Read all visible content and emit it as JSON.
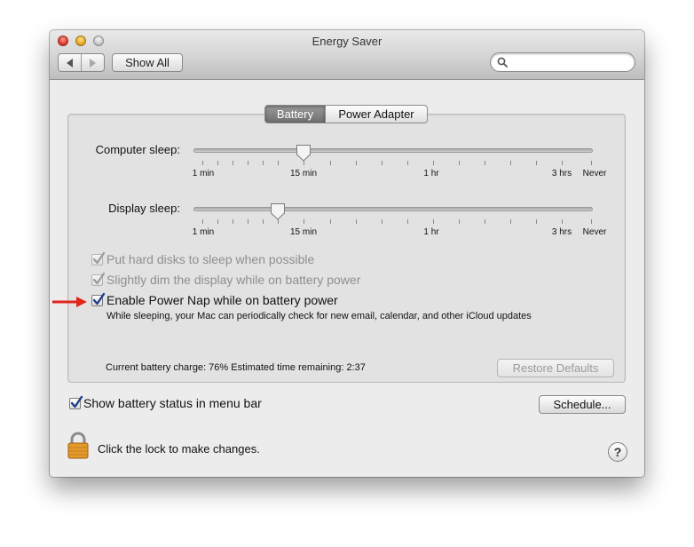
{
  "window": {
    "title": "Energy Saver"
  },
  "toolbar": {
    "show_all_label": "Show All",
    "search_placeholder": ""
  },
  "tabs": {
    "battery": "Battery",
    "power_adapter": "Power Adapter"
  },
  "computer_sleep": {
    "label": "Computer sleep:",
    "value": "15 min",
    "ticks": {
      "t1": "1 min",
      "t2": "15 min",
      "t3": "1 hr",
      "t4": "3 hrs",
      "t5": "Never"
    }
  },
  "display_sleep": {
    "label": "Display sleep:",
    "value": "10 min",
    "ticks": {
      "t1": "1 min",
      "t2": "15 min",
      "t3": "1 hr",
      "t4": "3 hrs",
      "t5": "Never"
    }
  },
  "options": {
    "hard_disks": {
      "label": "Put hard disks to sleep when possible",
      "checked": true,
      "enabled": false
    },
    "dim_display": {
      "label": "Slightly dim the display while on battery power",
      "checked": true,
      "enabled": false
    },
    "power_nap": {
      "label": "Enable Power Nap while on battery power",
      "checked": true,
      "description": "While sleeping, your Mac can periodically check for new email, calendar, and other iCloud updates"
    }
  },
  "battery_status": {
    "text": "Current battery charge: 76%  Estimated time remaining: 2:37"
  },
  "buttons": {
    "restore_defaults": "Restore Defaults",
    "schedule": "Schedule..."
  },
  "menu_bar_option": {
    "label": "Show battery status in menu bar",
    "checked": true
  },
  "lock": {
    "text": "Click the lock to make changes."
  },
  "help": {
    "label": "?"
  },
  "colors": {
    "annotation_arrow": "#e0251b",
    "checkmark": "#1f3c88"
  },
  "icons": [
    "search-icon",
    "lock-icon",
    "help-icon",
    "back-arrow-icon",
    "forward-arrow-icon",
    "checkmark-icon",
    "red-arrow-annotation"
  ]
}
